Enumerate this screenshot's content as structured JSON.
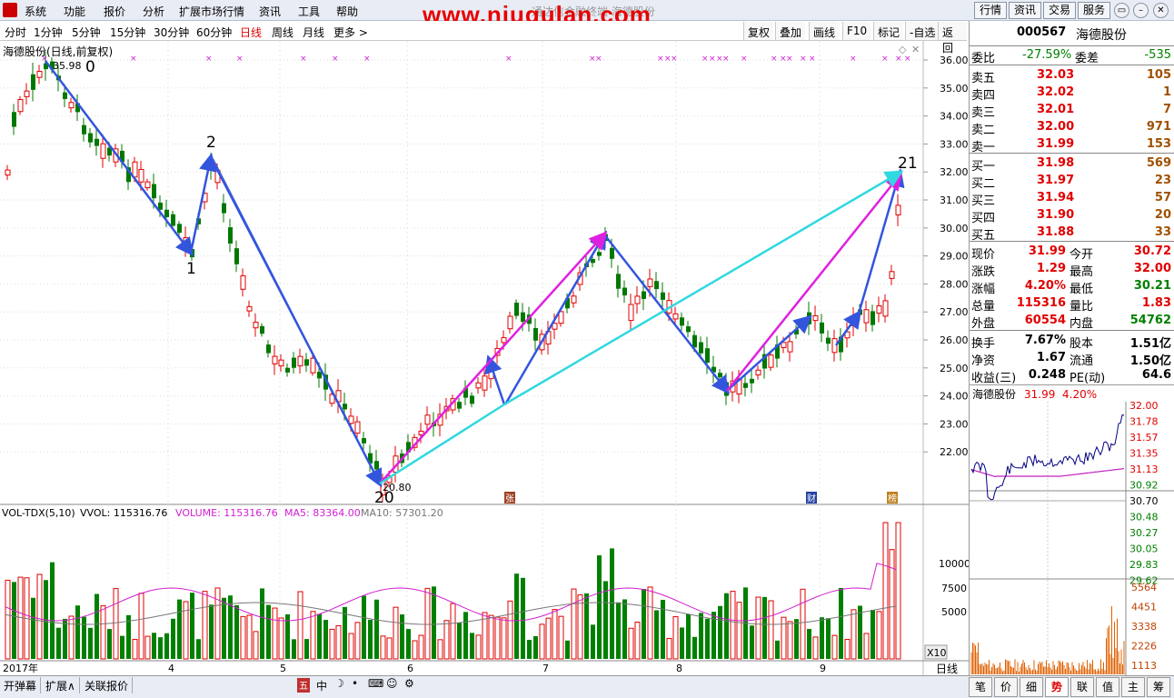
{
  "menu": {
    "items": [
      "系统",
      "功能",
      "报价",
      "分析",
      "扩展市场行情",
      "资讯",
      "工具",
      "帮助"
    ],
    "watermark": "www.niugulan.com",
    "hidden_title": "通达信金融终端 海德股份",
    "right_buttons": [
      "行情",
      "资讯",
      "交易",
      "服务"
    ]
  },
  "periods": {
    "items": [
      "分时",
      "1分钟",
      "5分钟",
      "15分钟",
      "30分钟",
      "60分钟",
      "日线",
      "周线",
      "月线",
      "更多 >"
    ],
    "active": "日线",
    "tools": [
      "复权",
      "叠加",
      "画线",
      "F10",
      "标记",
      "-自选",
      "返回"
    ]
  },
  "kline": {
    "title": "海德股份(日线,前复权)",
    "high_label": "35.98",
    "low_label": "20.80",
    "point_labels": [
      "0",
      "1",
      "2",
      "20",
      "21"
    ],
    "price_ticks": [
      "36.00",
      "35.00",
      "34.00",
      "33.00",
      "32.00",
      "31.00",
      "30.00",
      "29.00",
      "28.00",
      "27.00",
      "26.00",
      "25.00",
      "24.00",
      "23.00",
      "22.00"
    ],
    "event_markers": [
      "张",
      "财",
      "榜"
    ]
  },
  "volume": {
    "indicator": "VOL-TDX(5,10)",
    "vvol": "VVOL: 115316.76",
    "volume": "VOLUME: 115316.76",
    "ma5": "MA5: 83364.00",
    "ma10": "MA10: 57301.20",
    "ticks": [
      "10000",
      "7500",
      "5000"
    ],
    "unit": "X10"
  },
  "xaxis": {
    "labels": [
      "2017年",
      "4",
      "5",
      "6",
      "7",
      "8",
      "9"
    ],
    "period_label": "日线"
  },
  "quote": {
    "code": "000567",
    "name": "海德股份",
    "weibi_label": "委比",
    "weibi": "-27.59%",
    "weicha_label": "委差",
    "weicha": "-535",
    "asks": [
      {
        "label": "卖五",
        "price": "32.03",
        "vol": "105"
      },
      {
        "label": "卖四",
        "price": "32.02",
        "vol": "1"
      },
      {
        "label": "卖三",
        "price": "32.01",
        "vol": "7"
      },
      {
        "label": "卖二",
        "price": "32.00",
        "vol": "971"
      },
      {
        "label": "卖一",
        "price": "31.99",
        "vol": "153"
      }
    ],
    "bids": [
      {
        "label": "买一",
        "price": "31.98",
        "vol": "569"
      },
      {
        "label": "买二",
        "price": "31.97",
        "vol": "23"
      },
      {
        "label": "买三",
        "price": "31.94",
        "vol": "57"
      },
      {
        "label": "买四",
        "price": "31.90",
        "vol": "20"
      },
      {
        "label": "买五",
        "price": "31.88",
        "vol": "33"
      }
    ],
    "stats1": [
      {
        "l1": "现价",
        "v1": "31.99",
        "c1": "red",
        "l2": "今开",
        "v2": "30.72",
        "c2": "red"
      },
      {
        "l1": "涨跌",
        "v1": "1.29",
        "c1": "red",
        "l2": "最高",
        "v2": "32.00",
        "c2": "red"
      },
      {
        "l1": "涨幅",
        "v1": "4.20%",
        "c1": "red",
        "l2": "最低",
        "v2": "30.21",
        "c2": "grn"
      },
      {
        "l1": "总量",
        "v1": "115316",
        "c1": "red",
        "l2": "量比",
        "v2": "1.83",
        "c2": "red"
      },
      {
        "l1": "外盘",
        "v1": "60554",
        "c1": "red",
        "l2": "内盘",
        "v2": "54762",
        "c2": "grn"
      }
    ],
    "stats2": [
      {
        "l1": "换手",
        "v1": "7.67%",
        "l2": "股本",
        "v2": "1.51亿"
      },
      {
        "l1": "净资",
        "v1": "1.67",
        "l2": "流通",
        "v2": "1.50亿"
      },
      {
        "l1": "收益(三)",
        "v1": "0.248",
        "l2": "PE(动)",
        "v2": "64.6"
      }
    ]
  },
  "minichart": {
    "name": "海德股份",
    "price": "31.99",
    "pct": "4.20%",
    "price_ticks": [
      "32.00",
      "31.78",
      "31.57",
      "31.35",
      "31.13",
      "30.92",
      "30.70",
      "30.48",
      "30.27",
      "30.05",
      "29.83",
      "29.62"
    ],
    "vol_ticks": [
      "5564",
      "4451",
      "3338",
      "2226",
      "1113"
    ]
  },
  "bottom": {
    "buttons": [
      "开弹幕",
      "扩展∧",
      "关联报价"
    ],
    "center_icons": [
      "五",
      "中"
    ],
    "tabs": [
      "笔",
      "价",
      "细",
      "势",
      "联",
      "值",
      "主",
      "筹"
    ],
    "active_tab": "势"
  },
  "colors": {
    "up": "#e00000",
    "down": "#007800",
    "wave": "#3355dd",
    "magenta": "#e020e0",
    "cyan": "#30d8e0"
  }
}
